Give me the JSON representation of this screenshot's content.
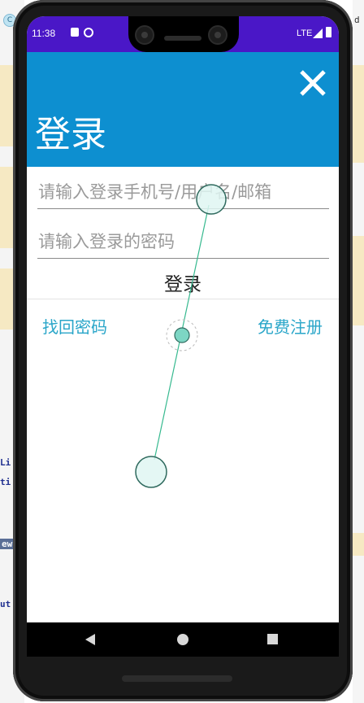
{
  "background": {
    "chip_label": "C",
    "code_lines": [
      "Li",
      "ti",
      "ew",
      "ut"
    ],
    "right_char": "d"
  },
  "status_bar": {
    "time": "11:38",
    "network": "LTE",
    "color": "#4a17c7"
  },
  "header": {
    "title": "登录",
    "close_icon": "close-icon",
    "color": "#0d8fd0"
  },
  "form": {
    "username_placeholder": "请输入登录手机号/用户名/邮箱",
    "password_placeholder": "请输入登录的密码",
    "username_value": "",
    "password_value": "",
    "login_label": "登录"
  },
  "links": {
    "forgot_password": "找回密码",
    "register": "免费注册",
    "color": "#2aa6c9"
  },
  "nav": {
    "back_icon": "back-triangle-icon",
    "home_icon": "home-circle-icon",
    "recent_icon": "recent-square-icon"
  }
}
